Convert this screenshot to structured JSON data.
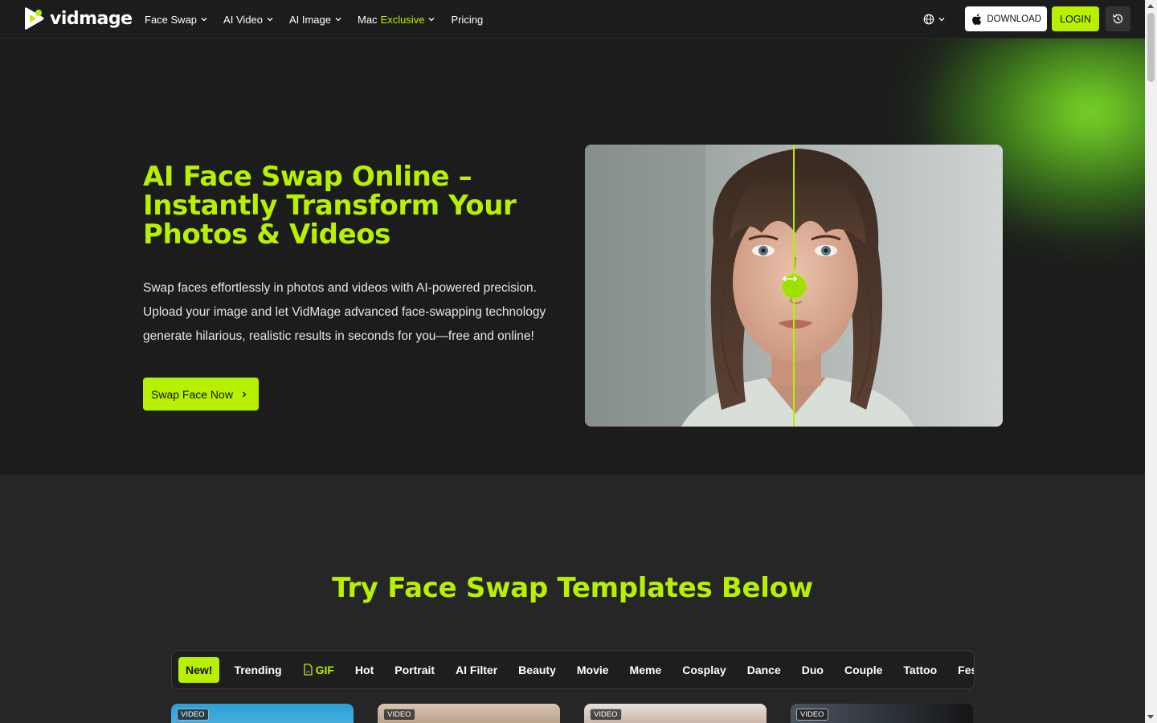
{
  "brand": {
    "name": "vidmage"
  },
  "nav": {
    "items": [
      {
        "label": "Face Swap",
        "dropdown": true
      },
      {
        "label": "AI Video",
        "dropdown": true
      },
      {
        "label": "AI Image",
        "dropdown": true
      },
      {
        "label_prefix": "Mac",
        "label_accent": "Exclusive",
        "dropdown": true
      },
      {
        "label": "Pricing",
        "dropdown": false
      }
    ]
  },
  "tools": {
    "language_icon": "globe-icon",
    "download_label": "DOWNLOAD",
    "login_label": "LOGIN",
    "history_icon": "history-icon"
  },
  "hero": {
    "title": "AI Face Swap Online – Instantly Transform Your Photos & Videos",
    "description": "Swap faces effortlessly in photos and videos with AI-powered precision. Upload your image and let VidMage advanced face-swapping technology generate hilarious, realistic results in seconds for you—free and online!",
    "cta_label": "Swap Face Now"
  },
  "templates": {
    "title": "Try Face Swap Templates Below",
    "tabs": [
      {
        "label": "New!",
        "active": true
      },
      {
        "label": "Trending"
      },
      {
        "label": "GIF",
        "icon": "gif-file-icon"
      },
      {
        "label": "Hot"
      },
      {
        "label": "Portrait"
      },
      {
        "label": "AI Filter"
      },
      {
        "label": "Beauty"
      },
      {
        "label": "Movie"
      },
      {
        "label": "Meme"
      },
      {
        "label": "Cosplay"
      },
      {
        "label": "Dance"
      },
      {
        "label": "Duo"
      },
      {
        "label": "Couple"
      },
      {
        "label": "Tattoo"
      },
      {
        "label": "Festiva"
      }
    ],
    "cards": [
      {
        "badge": "VIDEO"
      },
      {
        "badge": "VIDEO"
      },
      {
        "badge": "VIDEO"
      },
      {
        "badge": "VIDEO"
      }
    ]
  },
  "colors": {
    "accent": "#b7f000",
    "background": "#1c1c1c",
    "section": "#262626"
  }
}
